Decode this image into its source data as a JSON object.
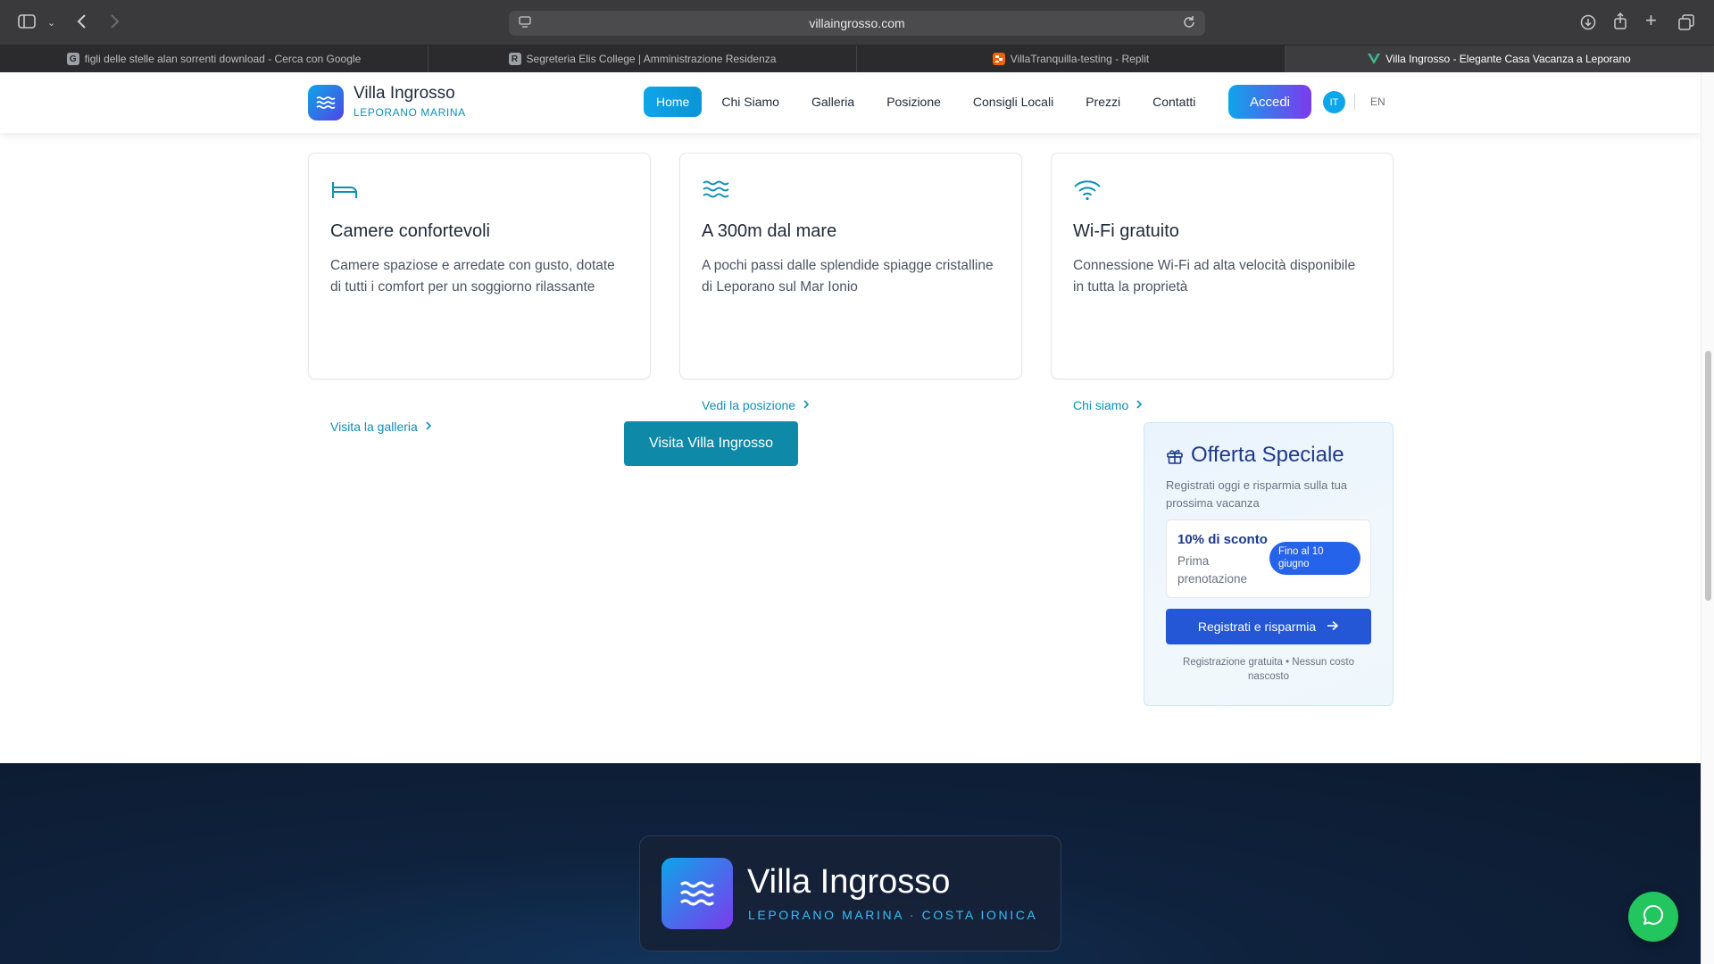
{
  "browser": {
    "url": "villaingrosso.com",
    "tabs": [
      {
        "title": "figli delle stelle alan sorrenti download - Cerca con Google",
        "favicon": "G",
        "favicon_color": "#9aa0a6"
      },
      {
        "title": "Segreteria Elis College | Amministrazione Residenza",
        "favicon": "R",
        "favicon_color": "#9aa0a6"
      },
      {
        "title": "VillaTranquilla-testing - Replit",
        "favicon": "replit",
        "favicon_color": "#f26207"
      },
      {
        "title": "Villa Ingrosso - Elegante Casa Vacanza a Leporano",
        "favicon": "V",
        "favicon_color": "#41b883"
      }
    ]
  },
  "header": {
    "brand_name": "Villa Ingrosso",
    "brand_sub": "LEPORANO MARINA",
    "nav": [
      {
        "label": "Home",
        "active": true
      },
      {
        "label": "Chi Siamo",
        "active": false
      },
      {
        "label": "Galleria",
        "active": false
      },
      {
        "label": "Posizione",
        "active": false
      },
      {
        "label": "Consigli Locali",
        "active": false
      },
      {
        "label": "Prezzi",
        "active": false
      },
      {
        "label": "Contatti",
        "active": false
      }
    ],
    "login": "Accedi",
    "lang_it": "IT",
    "lang_en": "EN"
  },
  "features": [
    {
      "icon": "bed-icon",
      "title": "Camere confortevoli",
      "description": "Camere spaziose e arredate con gusto, dotate di tutti i comfort per un soggiorno rilassante",
      "link": "Visita la galleria"
    },
    {
      "icon": "waves-icon",
      "title": "A 300m dal mare",
      "description": "A pochi passi dalle splendide spiagge cristalline di Leporano sul Mar Ionio",
      "link": "Vedi la posizione"
    },
    {
      "icon": "wifi-icon",
      "title": "Wi-Fi gratuito",
      "description": "Connessione Wi-Fi ad alta velocità disponibile in tutta la proprietà",
      "link": "Chi siamo"
    }
  ],
  "visit_button": "Visita Villa Ingrosso",
  "offer": {
    "title": "Offerta Speciale",
    "description": "Registrati oggi e risparmia sulla tua prossima vacanza",
    "discount_title": "10% di sconto",
    "discount_sub": "Prima prenotazione",
    "badge": "Fino al 10 giugno",
    "cta": "Registrati e risparmia",
    "note": "Registrazione gratuita • Nessun costo nascosto"
  },
  "footer": {
    "brand_name": "Villa Ingrosso",
    "brand_sub": "LEPORANO MARINA · COSTA IONICA"
  },
  "colors": {
    "accent": "#0ea5e9",
    "link": "#0e8fb5",
    "offer_blue": "#2457d6",
    "footer_bg": "#0f223d",
    "chat_green": "#22c55e"
  }
}
